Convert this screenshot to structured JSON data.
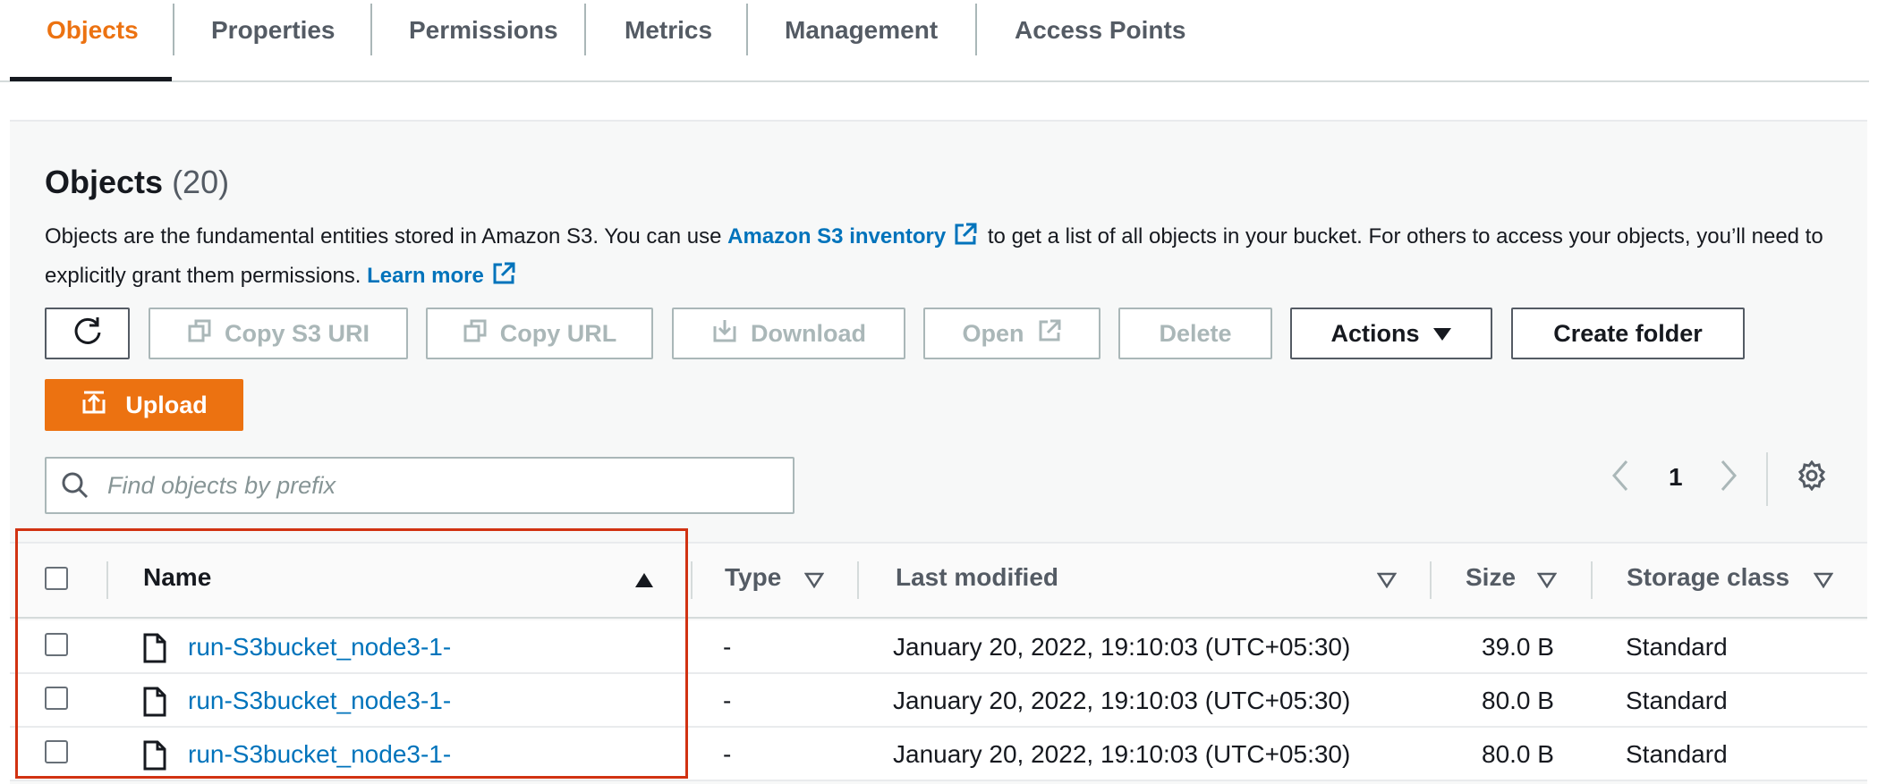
{
  "tabs": [
    {
      "label": "Objects",
      "active": true
    },
    {
      "label": "Properties"
    },
    {
      "label": "Permissions"
    },
    {
      "label": "Metrics"
    },
    {
      "label": "Management"
    },
    {
      "label": "Access Points"
    }
  ],
  "section": {
    "title": "Objects",
    "count": "(20)",
    "description_part1": "Objects are the fundamental entities stored in Amazon S3. You can use ",
    "inventory_link": "Amazon S3 inventory",
    "description_part2": "to get a list of all objects in your bucket. For others to access your objects, you’ll need to explicitly grant them permissions.",
    "learn_more": "Learn more"
  },
  "toolbar": {
    "refresh_icon": "refresh-icon",
    "copy_s3_uri": "Copy S3 URI",
    "copy_url": "Copy URL",
    "download": "Download",
    "open": "Open",
    "delete": "Delete",
    "actions": "Actions",
    "create_folder": "Create folder",
    "upload": "Upload"
  },
  "search": {
    "placeholder": "Find objects by prefix",
    "value": ""
  },
  "pagination": {
    "current_page": "1"
  },
  "table": {
    "columns": [
      "Name",
      "Type",
      "Last modified",
      "Size",
      "Storage class"
    ],
    "rows": [
      {
        "name": "run-S3bucket_node3-1-",
        "type": "-",
        "last_modified": "January 20, 2022, 19:10:03 (UTC+05:30)",
        "size": "39.0 B",
        "storage_class": "Standard"
      },
      {
        "name": "run-S3bucket_node3-1-",
        "type": "-",
        "last_modified": "January 20, 2022, 19:10:03 (UTC+05:30)",
        "size": "80.0 B",
        "storage_class": "Standard"
      },
      {
        "name": "run-S3bucket_node3-1-",
        "type": "-",
        "last_modified": "January 20, 2022, 19:10:03 (UTC+05:30)",
        "size": "80.0 B",
        "storage_class": "Standard"
      }
    ]
  },
  "colors": {
    "accent": "#ec7211",
    "link": "#0073bb",
    "highlight": "#d13212"
  }
}
